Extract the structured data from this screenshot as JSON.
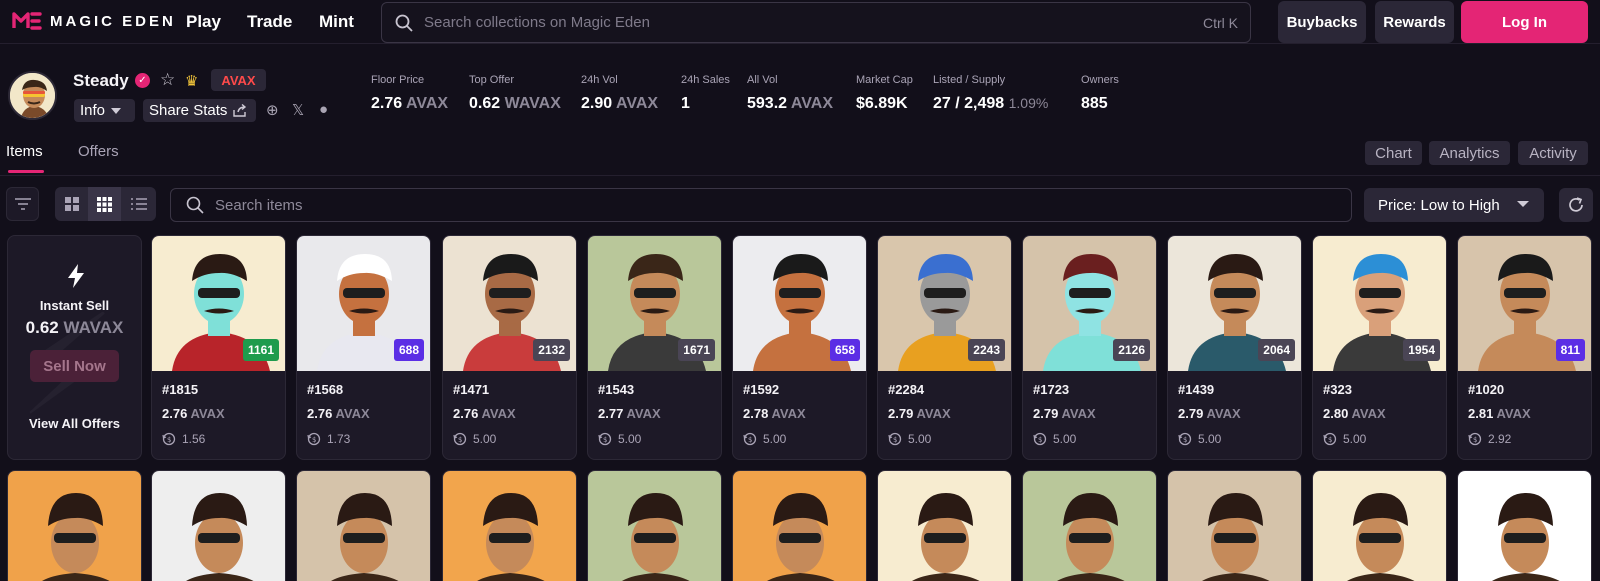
{
  "brand": {
    "name": "MAGIC EDEN",
    "accent": "#e42575"
  },
  "nav": {
    "play": "Play",
    "trade": "Trade",
    "mint": "Mint"
  },
  "search": {
    "placeholder": "Search collections on Magic Eden",
    "shortcut": "Ctrl  K"
  },
  "header_buttons": {
    "buybacks": "Buybacks",
    "rewards": "Rewards",
    "login": "Log In"
  },
  "collection": {
    "name": "Steady",
    "chain": "AVAX",
    "info_label": "Info",
    "share_label": "Share Stats"
  },
  "stats": [
    {
      "label": "Floor Price",
      "value": "2.76",
      "unit": "AVAX"
    },
    {
      "label": "Top Offer",
      "value": "0.62",
      "unit": "WAVAX"
    },
    {
      "label": "24h Vol",
      "value": "2.90",
      "unit": "AVAX"
    },
    {
      "label": "24h Sales",
      "value": "1",
      "unit": ""
    },
    {
      "label": "All Vol",
      "value": "593.2",
      "unit": "AVAX"
    },
    {
      "label": "Market Cap",
      "value": "$6.89K",
      "unit": ""
    },
    {
      "label": "Listed / Supply",
      "value": "27 / 2,498",
      "unit": "1.09%"
    },
    {
      "label": "Owners",
      "value": "885",
      "unit": ""
    }
  ],
  "tabs": {
    "items": "Items",
    "offers": "Offers"
  },
  "right_tabs": {
    "chart": "Chart",
    "analytics": "Analytics",
    "activity": "Activity"
  },
  "items_search": {
    "placeholder": "Search items"
  },
  "sort": {
    "selected": "Price: Low to High"
  },
  "instant_sell": {
    "title": "Instant Sell",
    "value": "0.62",
    "unit": "WAVAX",
    "button": "Sell Now",
    "link": "View All Offers"
  },
  "cards": [
    {
      "name": "#1815",
      "price": "2.76",
      "unit": "AVAX",
      "last": "1.56",
      "rank": "1161",
      "rank_color": "#1e9b4d",
      "bg": "#f7ecd0"
    },
    {
      "name": "#1568",
      "price": "2.76",
      "unit": "AVAX",
      "last": "1.73",
      "rank": "688",
      "rank_color": "#5b2ee5",
      "bg": "#e9e9ec"
    },
    {
      "name": "#1471",
      "price": "2.76",
      "unit": "AVAX",
      "last": "5.00",
      "rank": "2132",
      "rank_color": "#4a4555",
      "bg": "#ece2d2"
    },
    {
      "name": "#1543",
      "price": "2.77",
      "unit": "AVAX",
      "last": "5.00",
      "rank": "1671",
      "rank_color": "#4a4555",
      "bg": "#b9c79a"
    },
    {
      "name": "#1592",
      "price": "2.78",
      "unit": "AVAX",
      "last": "5.00",
      "rank": "658",
      "rank_color": "#5b2ee5",
      "bg": "#ececef"
    },
    {
      "name": "#2284",
      "price": "2.79",
      "unit": "AVAX",
      "last": "5.00",
      "rank": "2243",
      "rank_color": "#4a4555",
      "bg": "#d9c6ac"
    },
    {
      "name": "#1723",
      "price": "2.79",
      "unit": "AVAX",
      "last": "5.00",
      "rank": "2126",
      "rank_color": "#4a4555",
      "bg": "#d5c3aa"
    },
    {
      "name": "#1439",
      "price": "2.79",
      "unit": "AVAX",
      "last": "5.00",
      "rank": "2064",
      "rank_color": "#4a4555",
      "bg": "#ece6da"
    },
    {
      "name": "#323",
      "price": "2.80",
      "unit": "AVAX",
      "last": "5.00",
      "rank": "1954",
      "rank_color": "#4a4555",
      "bg": "#f7ecd0"
    },
    {
      "name": "#1020",
      "price": "2.81",
      "unit": "AVAX",
      "last": "2.92",
      "rank": "811",
      "rank_color": "#5b2ee5",
      "bg": "#d7c4ab"
    }
  ],
  "row2_backgrounds": [
    "#f0a24a",
    "#eeeeee",
    "#d5c3aa",
    "#f2a54c",
    "#b9c79a",
    "#f0a24a",
    "#f7ecd0",
    "#b9c79a",
    "#d5c3aa",
    "#f7ecd0",
    "#ffffff"
  ]
}
